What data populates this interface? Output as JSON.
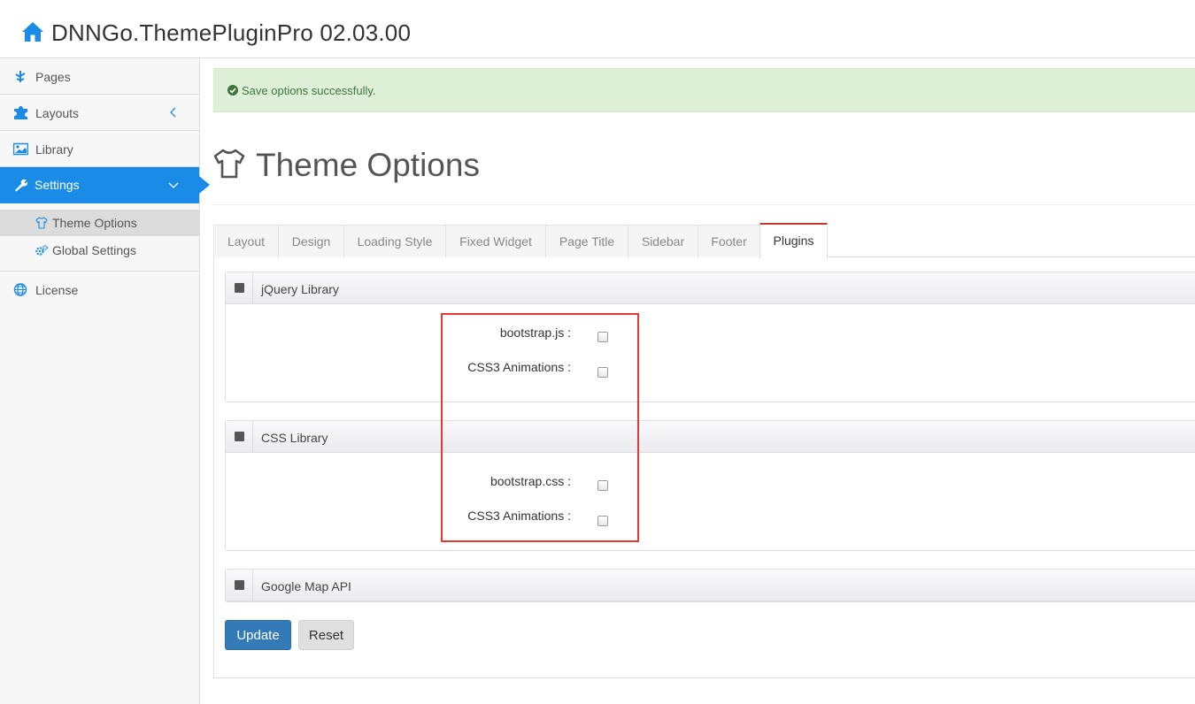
{
  "header": {
    "title": "DNNGo.ThemePluginPro 02.03.00"
  },
  "sidebar": {
    "items": [
      {
        "label": "Pages",
        "icon": "pages-icon"
      },
      {
        "label": "Layouts",
        "icon": "puzzle-icon"
      },
      {
        "label": "Library",
        "icon": "image-icon"
      },
      {
        "label": "Settings",
        "icon": "wrench-icon"
      },
      {
        "label": "License",
        "icon": "globe-icon"
      }
    ],
    "sub_items": [
      {
        "label": "Theme Options",
        "icon": "tshirt-icon"
      },
      {
        "label": "Global Settings",
        "icon": "gears-icon"
      }
    ]
  },
  "alert": {
    "message": "Save options successfully."
  },
  "page": {
    "title": "Theme Options"
  },
  "tabs": [
    "Layout",
    "Design",
    "Loading Style",
    "Fixed Widget",
    "Page Title",
    "Sidebar",
    "Footer",
    "Plugins"
  ],
  "active_tab": "Plugins",
  "panels": [
    {
      "title": "jQuery Library",
      "fields": [
        {
          "label": "bootstrap.js :",
          "checked": false
        },
        {
          "label": "CSS3 Animations :",
          "checked": false
        }
      ]
    },
    {
      "title": "CSS Library",
      "fields": [
        {
          "label": "bootstrap.css :",
          "checked": false
        },
        {
          "label": "CSS3 Animations :",
          "checked": false
        }
      ]
    },
    {
      "title": "Google Map API",
      "fields": []
    }
  ],
  "buttons": {
    "update": "Update",
    "reset": "Reset"
  },
  "colors": {
    "accent": "#1a8ce7",
    "primary_button": "#337ab7",
    "alert_bg": "#dff0d8",
    "alert_text": "#3c763d",
    "highlight": "#e53935",
    "active_tab_border": "#c0392b"
  }
}
